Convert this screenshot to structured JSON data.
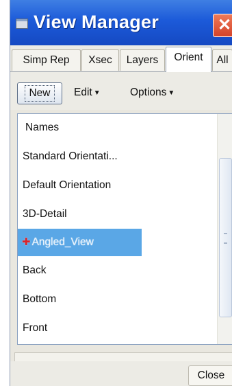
{
  "window": {
    "title": "View Manager",
    "close_glyph": "✕"
  },
  "tabs": [
    {
      "label": "Simp Rep",
      "active": false
    },
    {
      "label": "Xsec",
      "active": false
    },
    {
      "label": "Layers",
      "active": false
    },
    {
      "label": "Orient",
      "active": true
    },
    {
      "label": "All",
      "active": false
    }
  ],
  "toolbar": {
    "new_label": "New",
    "edit_label": "Edit",
    "options_label": "Options",
    "dropdown_glyph": "▼"
  },
  "list": {
    "header": "Names",
    "items": [
      {
        "label": "Standard Orientati..."
      },
      {
        "label": "Default Orientation"
      },
      {
        "label": "3D-Detail"
      },
      {
        "label": "Angled_View",
        "selected": true,
        "icon": "red-arrow-icon"
      },
      {
        "label": "Back"
      },
      {
        "label": "Bottom"
      },
      {
        "label": "Front"
      }
    ],
    "active_marker_glyph": "✚"
  },
  "footer": {
    "close_label": "Close"
  },
  "colors": {
    "titlebar": "#1c5ad9",
    "selection": "#5aa7e6",
    "close_button": "#d4432a",
    "active_marker": "#d8232a"
  }
}
